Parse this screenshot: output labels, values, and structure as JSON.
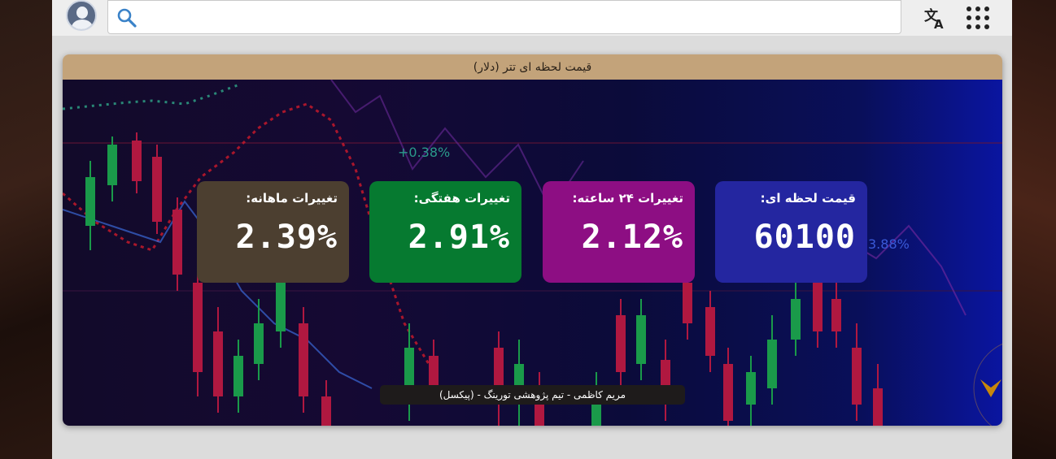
{
  "header": {
    "search": {
      "value": "",
      "placeholder": ""
    },
    "icons": {
      "avatar": "user-avatar-icon",
      "search": "search-icon",
      "translate": "translate-icon",
      "apps": "apps-grid-icon"
    }
  },
  "card": {
    "title": "قیمت لحظه ای تتر (دلار)",
    "tiles": [
      {
        "label": "قیمت لحظه ای:",
        "value": "60100",
        "color": "#2426a0"
      },
      {
        "label": "تغییرات ۲۴ ساعته:",
        "value": "2.12%",
        "color": "#8d0e83"
      },
      {
        "label": "تغییرات هفتگی:",
        "value": "2.91%",
        "color": "#067a30"
      },
      {
        "label": "تغییرات ماهانه:",
        "value": "2.39%",
        "color": "#4c3f30"
      }
    ],
    "background_texts": [
      "+0.38%",
      "3.88%"
    ],
    "credit": "مریم کاظمی - تیم پژوهشی تورینگ - (پیکسل)"
  },
  "colors": {
    "header_bar": "#c3a37a",
    "scroll_arrow": "#c8870c"
  }
}
